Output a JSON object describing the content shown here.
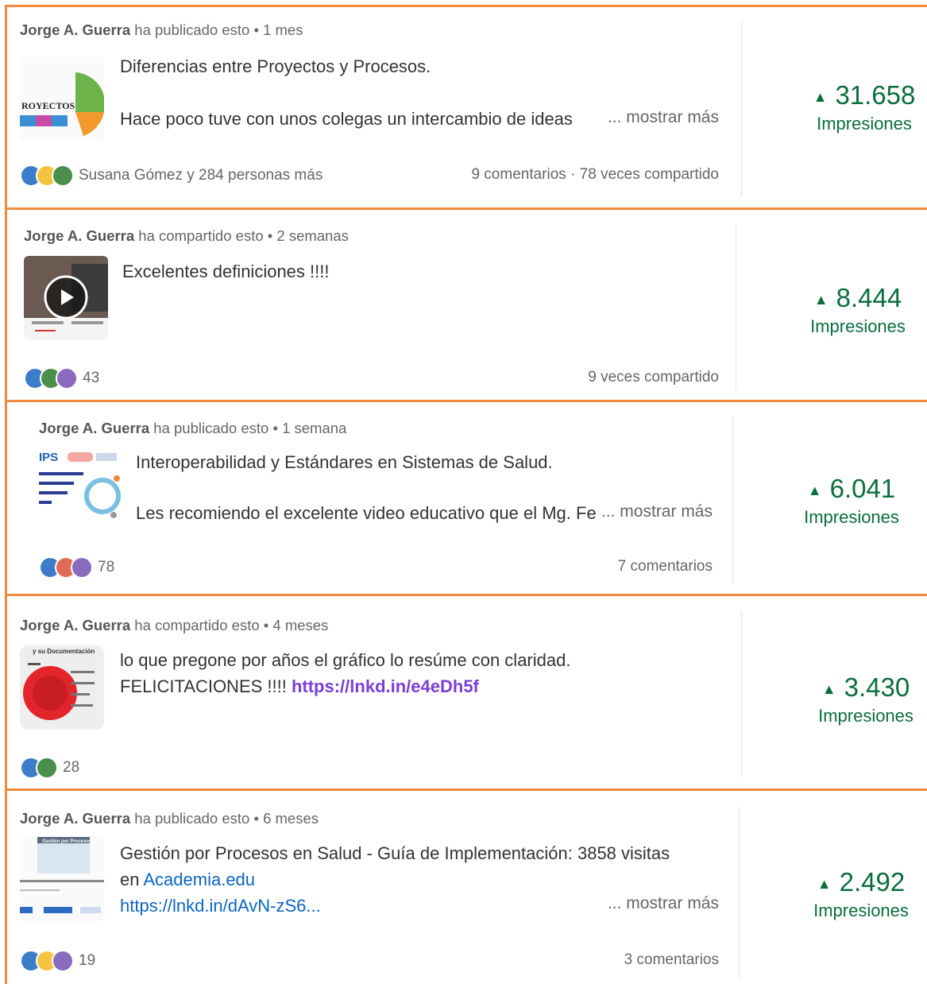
{
  "posts": [
    {
      "author": "Jorge A. Guerra",
      "action": "ha publicado esto",
      "time": "1 mes",
      "thumb_text": "ROYECTOS",
      "text_lines": [
        "Diferencias entre Proyectos y Procesos.",
        "",
        "Hace poco tuve con unos colegas un intercambio de ideas"
      ],
      "show_more": "... mostrar más",
      "reactions_text": "Susana Gómez y 284 personas más",
      "stats": "9 comentarios · 78 veces compartido",
      "impressions": "31.658",
      "impressions_label": "Impresiones",
      "reaction_icons": [
        "like-icon",
        "idea-icon",
        "praise-icon"
      ]
    },
    {
      "author": "Jorge A. Guerra",
      "action": "ha compartido esto",
      "time": "2 semanas",
      "text_lines": [
        "Excelentes definiciones !!!!"
      ],
      "reactions_text": "43",
      "stats": "9 veces compartido",
      "impressions": "8.444",
      "impressions_label": "Impresiones",
      "reaction_icons": [
        "like-icon",
        "praise-icon",
        "support-icon"
      ]
    },
    {
      "author": "Jorge A. Guerra",
      "action": "ha publicado esto",
      "time": "1 semana",
      "thumb_text": "IPS",
      "text_lines": [
        "Interoperabilidad y Estándares en Sistemas de Salud.",
        "",
        "Les recomiendo el excelente video educativo que el Mg. Fe"
      ],
      "show_more": "... mostrar más",
      "reactions_text": "78",
      "stats": "7 comentarios",
      "impressions": "6.041",
      "impressions_label": "Impresiones",
      "reaction_icons": [
        "like-icon",
        "love-icon",
        "support-icon"
      ]
    },
    {
      "author": "Jorge A. Guerra",
      "action": "ha compartido esto",
      "time": "4 meses",
      "thumb_text": "y su Documentación",
      "text_line1": "lo que pregone por años el gráfico lo resúme con claridad.",
      "text_line2": "FELICITACIONES !!!! ",
      "link": "https://lnkd.in/e4eDh5f",
      "reactions_text": "28",
      "impressions": "3.430",
      "impressions_label": "Impresiones",
      "reaction_icons": [
        "like-icon",
        "praise-icon"
      ]
    },
    {
      "author": "Jorge A. Guerra",
      "action": "ha publicado esto",
      "time": "6 meses",
      "thumb_text": "Gestión por Procesos",
      "text_line1": "Gestión por Procesos en Salud - Guía de Implementación: 3858 visitas",
      "text_line2_prefix": "en ",
      "text_line2_link": "Academia.edu",
      "text_line3": "https://lnkd.in/dAvN-zS6...",
      "show_more": "... mostrar más",
      "reactions_text": "19",
      "stats": "3 comentarios",
      "impressions": "2.492",
      "impressions_label": "Impresiones",
      "reaction_icons": [
        "like-icon",
        "idea-icon",
        "support-icon"
      ]
    }
  ]
}
